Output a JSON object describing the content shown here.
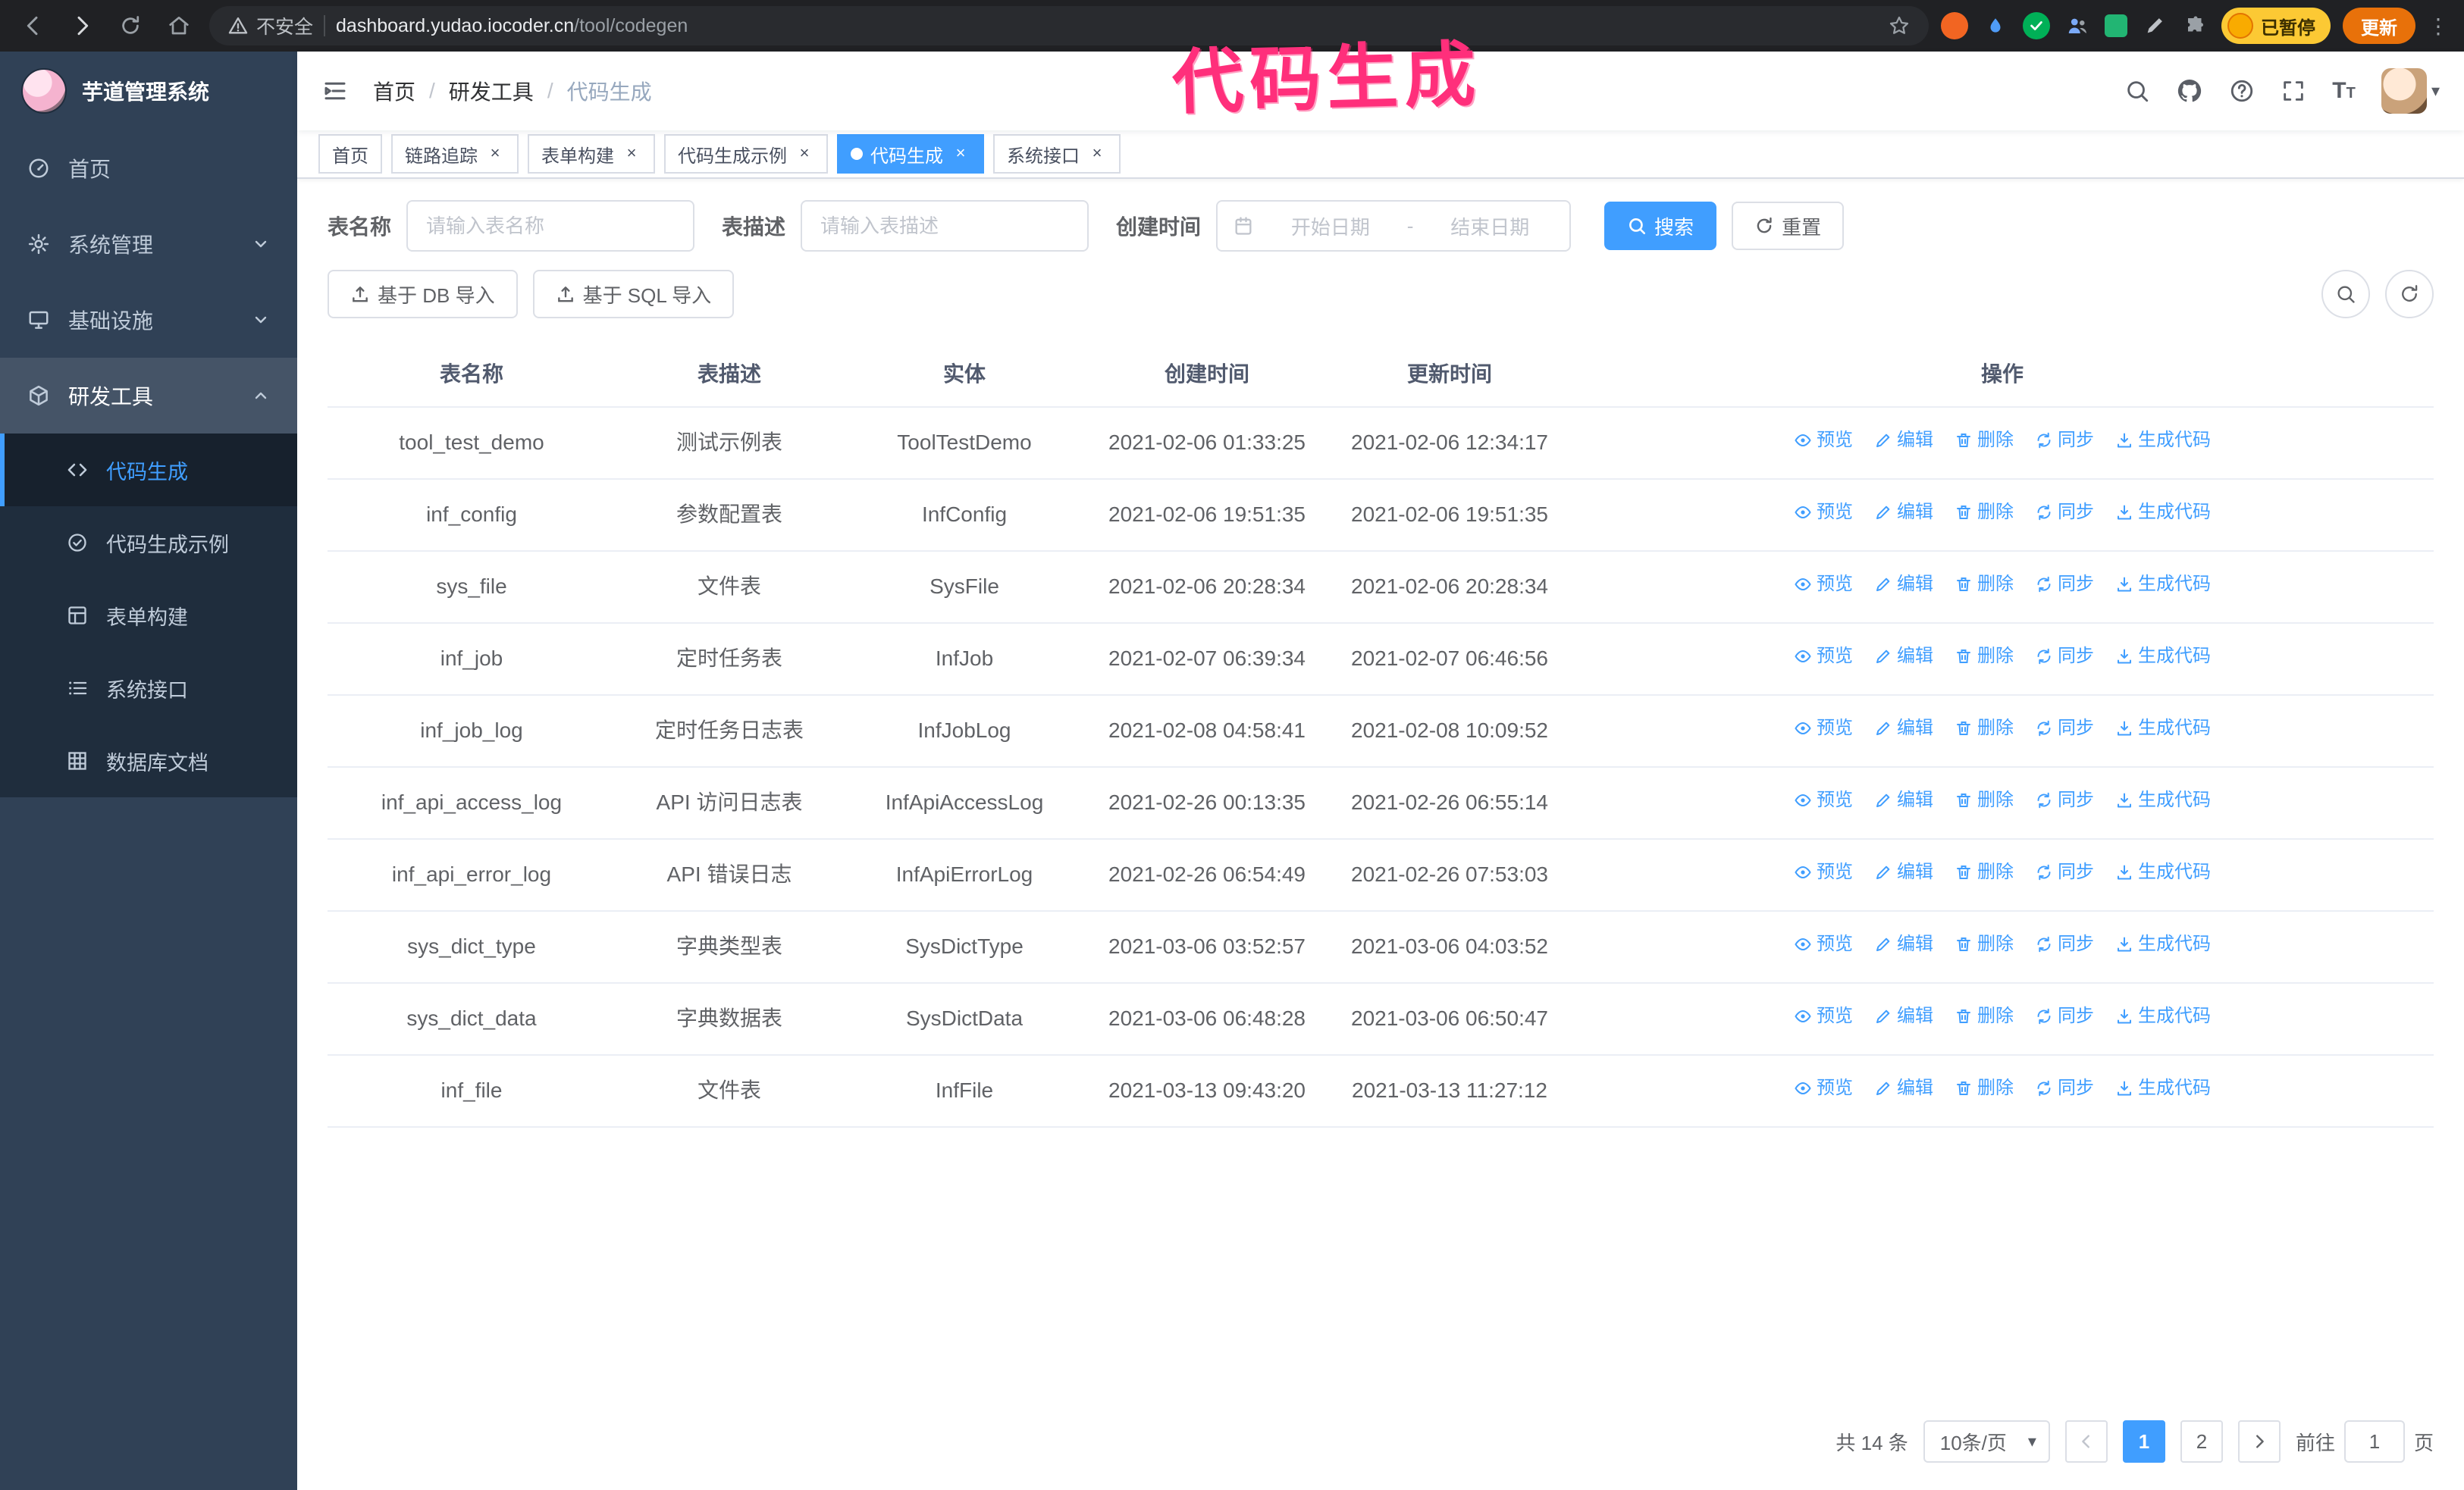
{
  "annotation": "代码生成",
  "browser": {
    "security_label": "不安全",
    "url_host": "dashboard.yudao.iocoder.cn",
    "url_path": "/tool/codegen",
    "paused_badge": "已暂停",
    "update_button": "更新"
  },
  "sidebar": {
    "logo_title": "芋道管理系统",
    "items": [
      {
        "label": "首页",
        "icon": "dashboard"
      },
      {
        "label": "系统管理",
        "icon": "gear",
        "expanded": false
      },
      {
        "label": "基础设施",
        "icon": "monitor",
        "expanded": false
      },
      {
        "label": "研发工具",
        "icon": "cube",
        "expanded": true
      }
    ],
    "submenu": [
      {
        "label": "代码生成",
        "icon": "code",
        "active": true
      },
      {
        "label": "代码生成示例",
        "icon": "badge-check",
        "active": false
      },
      {
        "label": "表单构建",
        "icon": "form-table",
        "active": false
      },
      {
        "label": "系统接口",
        "icon": "api-list",
        "active": false
      },
      {
        "label": "数据库文档",
        "icon": "db-grid",
        "active": false
      }
    ]
  },
  "header": {
    "breadcrumb": [
      "首页",
      "研发工具",
      "代码生成"
    ]
  },
  "tabs": [
    {
      "label": "首页",
      "closable": false,
      "active": false
    },
    {
      "label": "链路追踪",
      "closable": true,
      "active": false
    },
    {
      "label": "表单构建",
      "closable": true,
      "active": false
    },
    {
      "label": "代码生成示例",
      "closable": true,
      "active": false
    },
    {
      "label": "代码生成",
      "closable": true,
      "active": true
    },
    {
      "label": "系统接口",
      "closable": true,
      "active": false
    }
  ],
  "filters": {
    "table_name_label": "表名称",
    "table_name_placeholder": "请输入表名称",
    "table_desc_label": "表描述",
    "table_desc_placeholder": "请输入表描述",
    "create_time_label": "创建时间",
    "date_start_placeholder": "开始日期",
    "date_separator": "-",
    "date_end_placeholder": "结束日期",
    "search_button": "搜索",
    "reset_button": "重置"
  },
  "toolbar": {
    "import_db": "基于 DB 导入",
    "import_sql": "基于 SQL 导入"
  },
  "table": {
    "columns": [
      "表名称",
      "表描述",
      "实体",
      "创建时间",
      "更新时间",
      "操作"
    ],
    "actions": [
      {
        "label": "预览",
        "icon": "eye",
        "name": "preview"
      },
      {
        "label": "编辑",
        "icon": "edit",
        "name": "edit"
      },
      {
        "label": "删除",
        "icon": "delete",
        "name": "delete"
      },
      {
        "label": "同步",
        "icon": "sync",
        "name": "sync"
      },
      {
        "label": "生成代码",
        "icon": "download",
        "name": "generate-code"
      }
    ],
    "rows": [
      {
        "name": "tool_test_demo",
        "desc": "测试示例表",
        "entity": "ToolTestDemo",
        "create_time": "2021-02-06 01:33:25",
        "update_time": "2021-02-06 12:34:17"
      },
      {
        "name": "inf_config",
        "desc": "参数配置表",
        "entity": "InfConfig",
        "create_time": "2021-02-06 19:51:35",
        "update_time": "2021-02-06 19:51:35"
      },
      {
        "name": "sys_file",
        "desc": "文件表",
        "entity": "SysFile",
        "create_time": "2021-02-06 20:28:34",
        "update_time": "2021-02-06 20:28:34"
      },
      {
        "name": "inf_job",
        "desc": "定时任务表",
        "entity": "InfJob",
        "create_time": "2021-02-07 06:39:34",
        "update_time": "2021-02-07 06:46:56"
      },
      {
        "name": "inf_job_log",
        "desc": "定时任务日志表",
        "entity": "InfJobLog",
        "create_time": "2021-02-08 04:58:41",
        "update_time": "2021-02-08 10:09:52"
      },
      {
        "name": "inf_api_access_log",
        "desc": "API 访问日志表",
        "entity": "InfApiAccessLog",
        "create_time": "2021-02-26 00:13:35",
        "update_time": "2021-02-26 06:55:14"
      },
      {
        "name": "inf_api_error_log",
        "desc": "API 错误日志",
        "entity": "InfApiErrorLog",
        "create_time": "2021-02-26 06:54:49",
        "update_time": "2021-02-26 07:53:03"
      },
      {
        "name": "sys_dict_type",
        "desc": "字典类型表",
        "entity": "SysDictType",
        "create_time": "2021-03-06 03:52:57",
        "update_time": "2021-03-06 04:03:52"
      },
      {
        "name": "sys_dict_data",
        "desc": "字典数据表",
        "entity": "SysDictData",
        "create_time": "2021-03-06 06:48:28",
        "update_time": "2021-03-06 06:50:47"
      },
      {
        "name": "inf_file",
        "desc": "文件表",
        "entity": "InfFile",
        "create_time": "2021-03-13 09:43:20",
        "update_time": "2021-03-13 11:27:12"
      }
    ]
  },
  "pagination": {
    "total_text": "共 14 条",
    "page_size": "10条/页",
    "pages": [
      "1",
      "2"
    ],
    "active_page": "1",
    "goto_label": "前往",
    "goto_value": "1",
    "goto_suffix": "页"
  },
  "colors": {
    "primary": "#409eff",
    "sidebar_bg": "#304156",
    "submenu_bg": "#1f2d3d",
    "annotation_pink": "#ff2f7b",
    "update_button_bg": "#e8710a",
    "paused_badge_bg": "#fcc934"
  }
}
